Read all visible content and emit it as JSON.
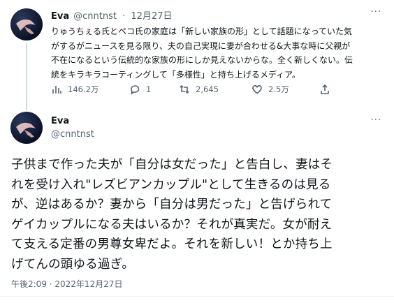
{
  "tweet1": {
    "author_name": "Eva",
    "author_handle": "@cnntnst",
    "date_separator": "·",
    "date": "12月27日",
    "more": "···",
    "body_lines": [
      "りゅうちぇる氏とペコ氏の家庭は「新しい家族の形」として話題になっていた気",
      "がするがニュースを見る限り、夫の自己実現に妻が合わせる&大事な時に父親が",
      "不在になるという伝統的な家族の形にしか見えないからな。全く新しくない。伝",
      "統をキラキラコーティングして「多様性」と持ち上げるメディア。"
    ],
    "actions": {
      "views": "146.2万",
      "replies": "1",
      "retweets": "2,645",
      "likes": "2.5万"
    }
  },
  "tweet2": {
    "author_name": "Eva",
    "author_handle": "@cnntnst",
    "more": "···",
    "body_lines": [
      "子供まで作った夫が「自分は女だった」と告白し、妻はそ",
      "れを受け入れ\"レズビアンカップル\"として生きるのは見る",
      "が、逆はあるか？妻から「自分は男だった」と告げられて",
      "ゲイカップルになる夫はいるか？それが真実だ。女が耐え",
      "て支える定番の男尊女卑だよ。それを新しい！とか持ち上",
      "げてんの頭ゆる過ぎ。"
    ],
    "timestamp": "午後2:09 · 2022年12月27日"
  },
  "colors": {
    "text": "#0f1419",
    "secondary": "#536471",
    "thread_line": "#cfd9de"
  },
  "icons": [
    "views-icon",
    "reply-icon",
    "retweet-icon",
    "like-icon",
    "share-icon",
    "more-icon"
  ]
}
